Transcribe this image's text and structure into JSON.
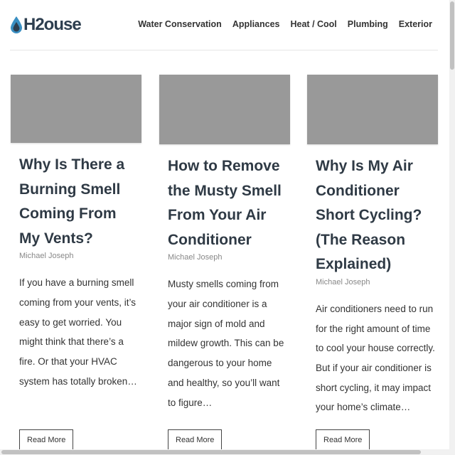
{
  "site": {
    "logo_text": "H2ouse",
    "logo_icon": "water-drop-icon",
    "accent_color": "#2d3e4f",
    "drop_color": "#3a8fc2"
  },
  "nav": {
    "items": [
      {
        "label": "Water Conservation"
      },
      {
        "label": "Appliances"
      },
      {
        "label": "Heat / Cool"
      },
      {
        "label": "Plumbing"
      },
      {
        "label": "Exterior"
      }
    ]
  },
  "posts": [
    {
      "title": "Why Is There a Burning Smell Coming From My Vents?",
      "author": "Michael Joseph",
      "excerpt": "If you have a burning smell coming from your vents, it’s easy to get worried. You might think that there’s a fire. Or that your HVAC system has totally broken…",
      "button": "Read More"
    },
    {
      "title": "How to Remove the Musty Smell From Your Air Conditioner",
      "author": "Michael Joseph",
      "excerpt": "Musty smells coming from your air conditioner is a major sign of mold and mildew growth. This can be dangerous to your home and healthy, so you’ll want to figure…",
      "button": "Read More"
    },
    {
      "title": "Why Is My Air Conditioner Short Cycling? (The Reason Explained)",
      "author": "Michael Joseph",
      "excerpt": "Air conditioners need to run for the right amount of time to cool your house correctly. But if your air conditioner is short cycling, it may impact your home’s climate…",
      "button": "Read More"
    }
  ]
}
